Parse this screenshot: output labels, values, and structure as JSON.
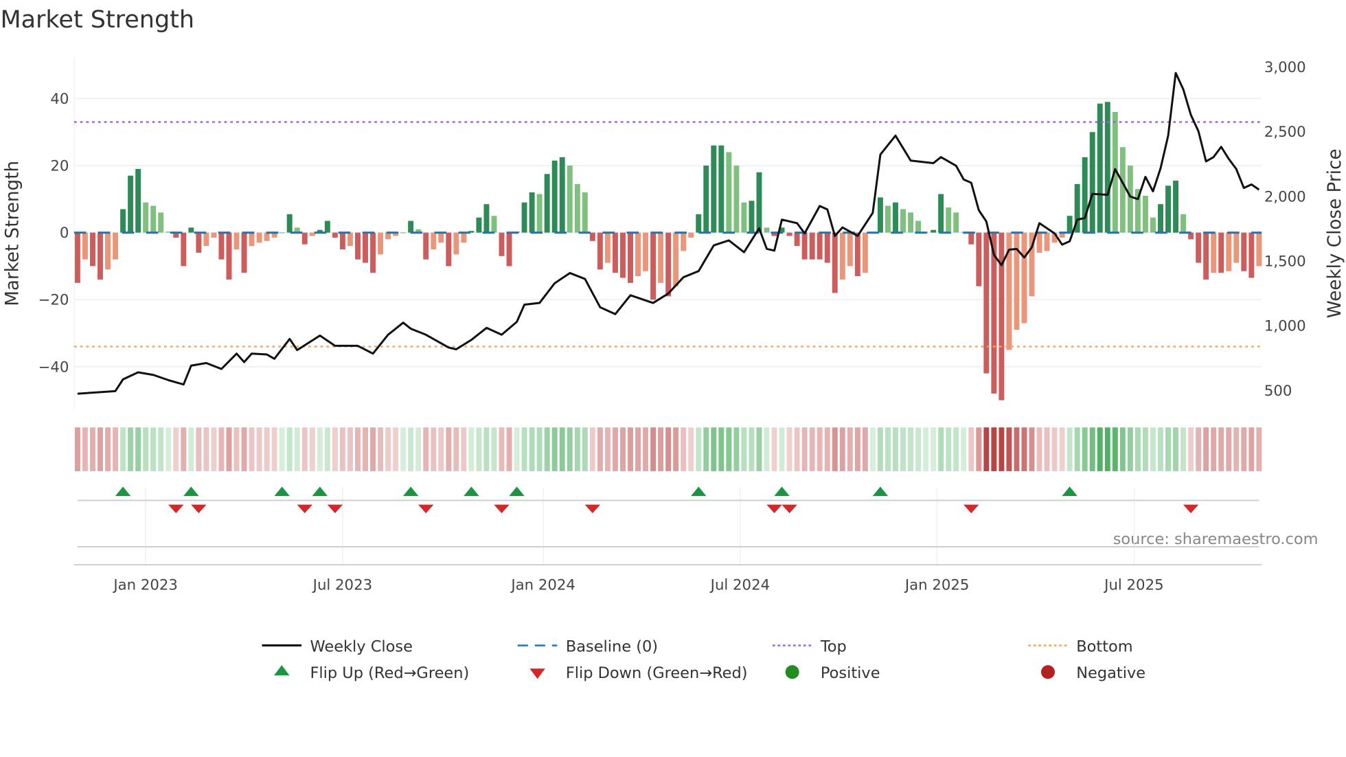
{
  "chart_data": {
    "type": "bar",
    "title": "Market Strength",
    "ylabel": "Market Strength",
    "y2label": "Weekly Close Price",
    "ylim": [
      -53,
      52.5
    ],
    "y2lim": [
      347,
      3080
    ],
    "yticks": [
      -40,
      -20,
      0,
      20,
      40
    ],
    "yticklabels": [
      "−40",
      "−20",
      "0",
      "20",
      "40"
    ],
    "y2ticks": [
      500,
      1000,
      1500,
      2000,
      2500,
      3000
    ],
    "y2ticklabels": [
      "500",
      "1,000",
      "1,500",
      "2,000",
      "2,500",
      "3,000"
    ],
    "xticks": [
      {
        "week": 9,
        "label": "Jan 2023"
      },
      {
        "week": 35,
        "label": "Jul 2023"
      },
      {
        "week": 61.5,
        "label": "Jan 2024"
      },
      {
        "week": 87.5,
        "label": "Jul 2024"
      },
      {
        "week": 113.5,
        "label": "Jan 2025"
      },
      {
        "week": 139.5,
        "label": "Jul 2025"
      }
    ],
    "top_level": 33,
    "bottom_level": -34,
    "baseline": 0,
    "strength": [
      -15,
      -8,
      -10,
      -14,
      -11,
      -8,
      7,
      17,
      19,
      9,
      8,
      6,
      0.3,
      -1.5,
      -10,
      1.5,
      -6,
      -4,
      -1.5,
      -8,
      -14,
      -5,
      -12,
      -4,
      -3,
      -2.5,
      -1.5,
      0,
      5.5,
      1.5,
      -3.5,
      -1,
      0.8,
      3.5,
      -1.5,
      -5,
      -4,
      -8,
      -9,
      -12,
      -6.5,
      -2,
      -1,
      0,
      3.5,
      1,
      -8,
      -5,
      -3,
      -10,
      -6.5,
      -3,
      0.5,
      4.5,
      8.5,
      5,
      -7,
      -10,
      0.3,
      9,
      12,
      11.5,
      17.5,
      21.5,
      22.5,
      20,
      14.5,
      12,
      -2.5,
      -11,
      -9,
      -12,
      -13.5,
      -15,
      -13,
      -11.5,
      -20,
      -15,
      -19,
      -16,
      -5.5,
      -1.5,
      5.5,
      20,
      26,
      26,
      24,
      20,
      9,
      9.5,
      18,
      1.5,
      -1,
      1.5,
      -1,
      -4,
      -8,
      -8,
      -8,
      -9,
      -18,
      -14,
      -10,
      -13,
      -12,
      0,
      10.5,
      8,
      9,
      7,
      6,
      3.5,
      0.2,
      0.8,
      11.5,
      7.5,
      6,
      0.2,
      -3.5,
      -16,
      -42,
      -48,
      -50,
      -35,
      -29,
      -27,
      -19,
      -6,
      -5.5,
      -3,
      -1.5,
      5,
      14.5,
      22.5,
      30,
      38.5,
      39,
      36,
      25.5,
      20,
      13,
      11,
      4.5,
      8.5,
      14,
      15.5,
      5.5,
      -2,
      -9,
      -14,
      -12,
      -12,
      -11.5,
      -9,
      -11.5,
      -13.5,
      -10
    ],
    "weekly_close_points": [
      [
        0,
        475
      ],
      [
        5,
        495
      ],
      [
        6,
        586
      ],
      [
        8,
        640
      ],
      [
        10,
        620
      ],
      [
        12,
        580
      ],
      [
        14,
        546
      ],
      [
        15,
        692
      ],
      [
        17,
        712
      ],
      [
        19,
        666
      ],
      [
        21,
        785
      ],
      [
        22,
        719
      ],
      [
        23,
        785
      ],
      [
        25,
        778
      ],
      [
        26,
        745
      ],
      [
        28,
        898
      ],
      [
        29,
        812
      ],
      [
        32,
        924
      ],
      [
        34,
        845
      ],
      [
        37,
        845
      ],
      [
        39,
        785
      ],
      [
        41,
        931
      ],
      [
        43,
        1024
      ],
      [
        44,
        977
      ],
      [
        46,
        931
      ],
      [
        49,
        832
      ],
      [
        50,
        818
      ],
      [
        52,
        891
      ],
      [
        54,
        984
      ],
      [
        56,
        931
      ],
      [
        58,
        1030
      ],
      [
        59,
        1163
      ],
      [
        61,
        1176
      ],
      [
        63,
        1329
      ],
      [
        65,
        1408
      ],
      [
        67,
        1362
      ],
      [
        69,
        1143
      ],
      [
        71,
        1090
      ],
      [
        73,
        1236
      ],
      [
        76,
        1176
      ],
      [
        78,
        1249
      ],
      [
        80,
        1375
      ],
      [
        82,
        1422
      ],
      [
        84,
        1621
      ],
      [
        86,
        1660
      ],
      [
        88,
        1568
      ],
      [
        90,
        1753
      ],
      [
        91,
        1594
      ],
      [
        92,
        1581
      ],
      [
        93,
        1820
      ],
      [
        95,
        1793
      ],
      [
        96,
        1714
      ],
      [
        98,
        1926
      ],
      [
        99,
        1899
      ],
      [
        100,
        1694
      ],
      [
        101,
        1760
      ],
      [
        103,
        1694
      ],
      [
        105,
        1873
      ],
      [
        106,
        2324
      ],
      [
        108,
        2470
      ],
      [
        110,
        2277
      ],
      [
        113,
        2257
      ],
      [
        114,
        2304
      ],
      [
        116,
        2237
      ],
      [
        117,
        2131
      ],
      [
        118,
        2105
      ],
      [
        119,
        1893
      ],
      [
        120,
        1806
      ],
      [
        121,
        1548
      ],
      [
        122,
        1468
      ],
      [
        123,
        1588
      ],
      [
        124,
        1594
      ],
      [
        125,
        1528
      ],
      [
        126,
        1607
      ],
      [
        127,
        1793
      ],
      [
        129,
        1714
      ],
      [
        130,
        1627
      ],
      [
        131,
        1653
      ],
      [
        132,
        1820
      ],
      [
        133,
        1833
      ],
      [
        134,
        2019
      ],
      [
        136,
        2012
      ],
      [
        137,
        2211
      ],
      [
        139,
        1999
      ],
      [
        140,
        1979
      ],
      [
        141,
        2151
      ],
      [
        142,
        2039
      ],
      [
        143,
        2218
      ],
      [
        144,
        2470
      ],
      [
        145,
        2954
      ],
      [
        146,
        2828
      ],
      [
        147,
        2629
      ],
      [
        148,
        2503
      ],
      [
        149,
        2271
      ],
      [
        150,
        2304
      ],
      [
        151,
        2383
      ],
      [
        152,
        2290
      ],
      [
        153,
        2211
      ],
      [
        154,
        2065
      ],
      [
        155,
        2092
      ],
      [
        156,
        2052
      ]
    ],
    "flip_up_weeks": [
      6,
      15,
      27,
      32,
      44,
      52,
      58,
      82,
      93,
      106,
      131
    ],
    "flip_down_weeks": [
      13,
      16,
      30,
      34,
      46,
      56,
      68,
      92,
      94,
      118,
      147
    ],
    "legend": [
      {
        "key": "weekly_close",
        "label": "Weekly Close"
      },
      {
        "key": "baseline",
        "label": "Baseline (0)"
      },
      {
        "key": "top",
        "label": "Top"
      },
      {
        "key": "bottom",
        "label": "Bottom"
      },
      {
        "key": "flip_up",
        "label": "Flip Up (Red→Green)"
      },
      {
        "key": "flip_down",
        "label": "Flip Down (Green→Red)"
      },
      {
        "key": "positive",
        "label": "Positive"
      },
      {
        "key": "negative",
        "label": "Negative"
      }
    ],
    "legend_placement": "bottom",
    "source": "source: sharemaestro.com",
    "colors": {
      "pos_strong": "#2e8b57",
      "pos_weak": "#80c07f",
      "neg_strong": "#cd5c5c",
      "neg_weak": "#e9967a",
      "close": "#111111",
      "baseline": "#1f77b4",
      "top": "#9966dd",
      "bottom": "#f4a460",
      "flip_up": "#1a9641",
      "flip_down": "#d62728",
      "positive": "#228b22",
      "negative": "#b22222"
    }
  }
}
